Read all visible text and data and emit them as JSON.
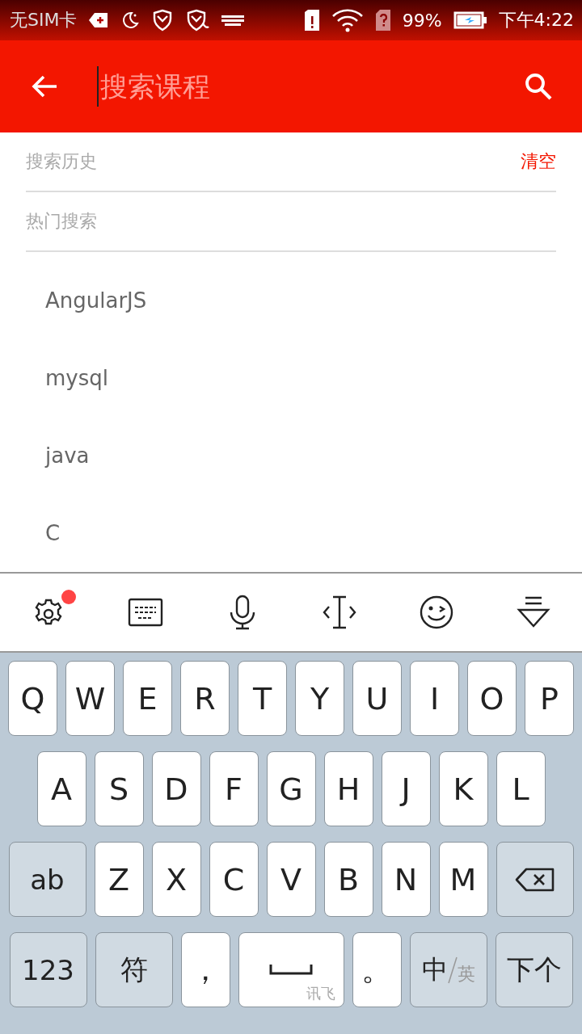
{
  "status_bar": {
    "carrier": "无SIM卡",
    "battery": "99%",
    "time": "下午4:22"
  },
  "search_bar": {
    "placeholder": "搜索课程"
  },
  "history": {
    "title": "搜索历史",
    "clear": "清空"
  },
  "hot": {
    "title": "热门搜索",
    "items": [
      "AngularJS",
      "mysql",
      "java",
      "C"
    ]
  },
  "keyboard_toolbar": {
    "settings_notification": true
  },
  "keyboard": {
    "rows": [
      {
        "keys": [
          {
            "kind": "letter",
            "label": "Q"
          },
          {
            "kind": "letter",
            "label": "W"
          },
          {
            "kind": "letter",
            "label": "E"
          },
          {
            "kind": "letter",
            "label": "R"
          },
          {
            "kind": "letter",
            "label": "T"
          },
          {
            "kind": "letter",
            "label": "Y"
          },
          {
            "kind": "letter",
            "label": "U"
          },
          {
            "kind": "letter",
            "label": "I"
          },
          {
            "kind": "letter",
            "label": "O"
          },
          {
            "kind": "letter",
            "label": "P"
          }
        ]
      },
      {
        "keys": [
          {
            "kind": "letter",
            "label": "A"
          },
          {
            "kind": "letter",
            "label": "S"
          },
          {
            "kind": "letter",
            "label": "D"
          },
          {
            "kind": "letter",
            "label": "F"
          },
          {
            "kind": "letter",
            "label": "G"
          },
          {
            "kind": "letter",
            "label": "H"
          },
          {
            "kind": "letter",
            "label": "J"
          },
          {
            "kind": "letter",
            "label": "K"
          },
          {
            "kind": "letter",
            "label": "L"
          }
        ]
      },
      {
        "keys": [
          {
            "kind": "function",
            "label": "ab"
          },
          {
            "kind": "letter",
            "label": "Z"
          },
          {
            "kind": "letter",
            "label": "X"
          },
          {
            "kind": "letter",
            "label": "C"
          },
          {
            "kind": "letter",
            "label": "V"
          },
          {
            "kind": "letter",
            "label": "B"
          },
          {
            "kind": "letter",
            "label": "N"
          },
          {
            "kind": "letter",
            "label": "M"
          },
          {
            "kind": "backspace"
          }
        ]
      },
      {
        "keys": [
          {
            "kind": "function",
            "label": "123"
          },
          {
            "kind": "wide",
            "label": "符"
          },
          {
            "kind": "letter",
            "label": "，"
          },
          {
            "kind": "space",
            "sublabel": "讯飞"
          },
          {
            "kind": "letter",
            "label": "。"
          },
          {
            "kind": "language",
            "label": "中",
            "sublabel": "英"
          },
          {
            "kind": "function",
            "label": "下个"
          }
        ]
      }
    ]
  }
}
